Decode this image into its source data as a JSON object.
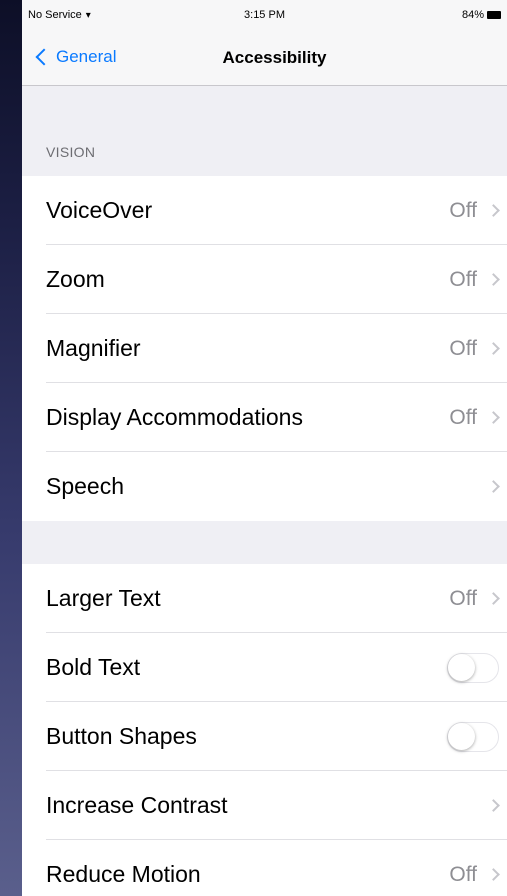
{
  "status_bar": {
    "carrier": "No Service",
    "wifi_icon": "wifi-icon",
    "time": "3:15 PM",
    "battery": "84%",
    "battery_icon": "battery-icon"
  },
  "nav": {
    "back_label": "General",
    "title": "Accessibility",
    "accent_color": "#0a7aff"
  },
  "vision": {
    "header": "VISION",
    "items": [
      {
        "label": "VoiceOver",
        "value": "Off"
      },
      {
        "label": "Zoom",
        "value": "Off"
      },
      {
        "label": "Magnifier",
        "value": "Off"
      },
      {
        "label": "Display Accommodations",
        "value": "Off"
      },
      {
        "label": "Speech",
        "value": ""
      }
    ]
  },
  "text_group": {
    "items": [
      {
        "label": "Larger Text",
        "value": "Off",
        "type": "disclosure"
      },
      {
        "label": "Bold Text",
        "type": "toggle",
        "on": false
      },
      {
        "label": "Button Shapes",
        "type": "toggle",
        "on": false
      },
      {
        "label": "Increase Contrast",
        "value": "",
        "type": "disclosure"
      },
      {
        "label": "Reduce Motion",
        "value": "Off",
        "type": "disclosure"
      }
    ]
  }
}
